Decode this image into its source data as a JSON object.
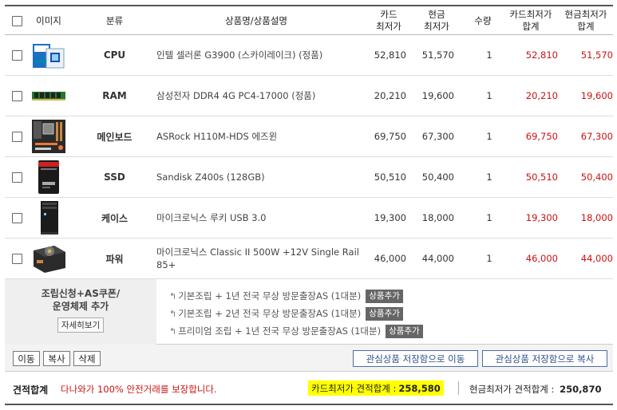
{
  "header": {
    "image": "이미지",
    "category": "분류",
    "product": "상품명/상품설명",
    "card_min_1": "카드",
    "card_min_2": "최저가",
    "cash_min_1": "현금",
    "cash_min_2": "최저가",
    "qty": "수량",
    "card_total_1": "카드최저가",
    "card_total_2": "합계",
    "cash_total_1": "현금최저가",
    "cash_total_2": "합계"
  },
  "rows": [
    {
      "category": "CPU",
      "name": "인텔 셀러론 G3900 (스카이레이크) (정품)",
      "card": "52,810",
      "cash": "51,570",
      "qty": "1",
      "card_total": "52,810",
      "cash_total": "51,570",
      "icon": "cpu-box-image"
    },
    {
      "category": "RAM",
      "name": "삼성전자 DDR4 4G PC4-17000 (정품)",
      "card": "20,210",
      "cash": "19,600",
      "qty": "1",
      "card_total": "20,210",
      "cash_total": "19,600",
      "icon": "ram-module-image"
    },
    {
      "category": "메인보드",
      "name": "ASRock H110M-HDS 에즈윈",
      "card": "69,750",
      "cash": "67,300",
      "qty": "1",
      "card_total": "69,750",
      "cash_total": "67,300",
      "icon": "motherboard-image"
    },
    {
      "category": "SSD",
      "name": "Sandisk Z400s (128GB)",
      "card": "50,510",
      "cash": "50,400",
      "qty": "1",
      "card_total": "50,510",
      "cash_total": "50,400",
      "icon": "ssd-image"
    },
    {
      "category": "케이스",
      "name": "마이크로닉스 루키 USB 3.0",
      "card": "19,300",
      "cash": "18,000",
      "qty": "1",
      "card_total": "19,300",
      "cash_total": "18,000",
      "icon": "pc-case-image"
    },
    {
      "category": "파워",
      "name": "마이크로닉스 Classic II 500W +12V Single Rail 85+",
      "card": "46,000",
      "cash": "44,000",
      "qty": "1",
      "card_total": "46,000",
      "cash_total": "44,000",
      "icon": "power-supply-image"
    }
  ],
  "options": {
    "title_1": "조립신청+AS쿠폰/",
    "title_2": "운영체제 추가",
    "detail_button": "자세히보기",
    "items": [
      {
        "text": "기본조립 + 1년 전국 무상 방문출장AS (1대분)",
        "button": "상품추가"
      },
      {
        "text": "기본조립 + 2년 전국 무상 방문출장AS (1대분)",
        "button": "상품추가"
      },
      {
        "text": "프리미엄 조립 + 1년 전국 무상 방문출장AS (1대분)",
        "button": "상품추가"
      }
    ]
  },
  "actions": {
    "move": "이동",
    "copy": "복사",
    "delete": "삭제",
    "move_to_wishlist": "관심상품 저장함으로 이동",
    "copy_to_wishlist": "관심상품 저장함으로 복사"
  },
  "total": {
    "label": "견적합계",
    "guarantee": "다나와가 100% 안전거래를 보장합니다.",
    "card_label": "카드최저가 견적합계 :",
    "card_value": "258,580",
    "cash_label": "현금최저가 견적합계 :",
    "cash_value": "250,870"
  },
  "colors": {
    "price_red": "#cc1111",
    "highlight": "#ffff00",
    "link_blue": "#2c4f8c"
  }
}
